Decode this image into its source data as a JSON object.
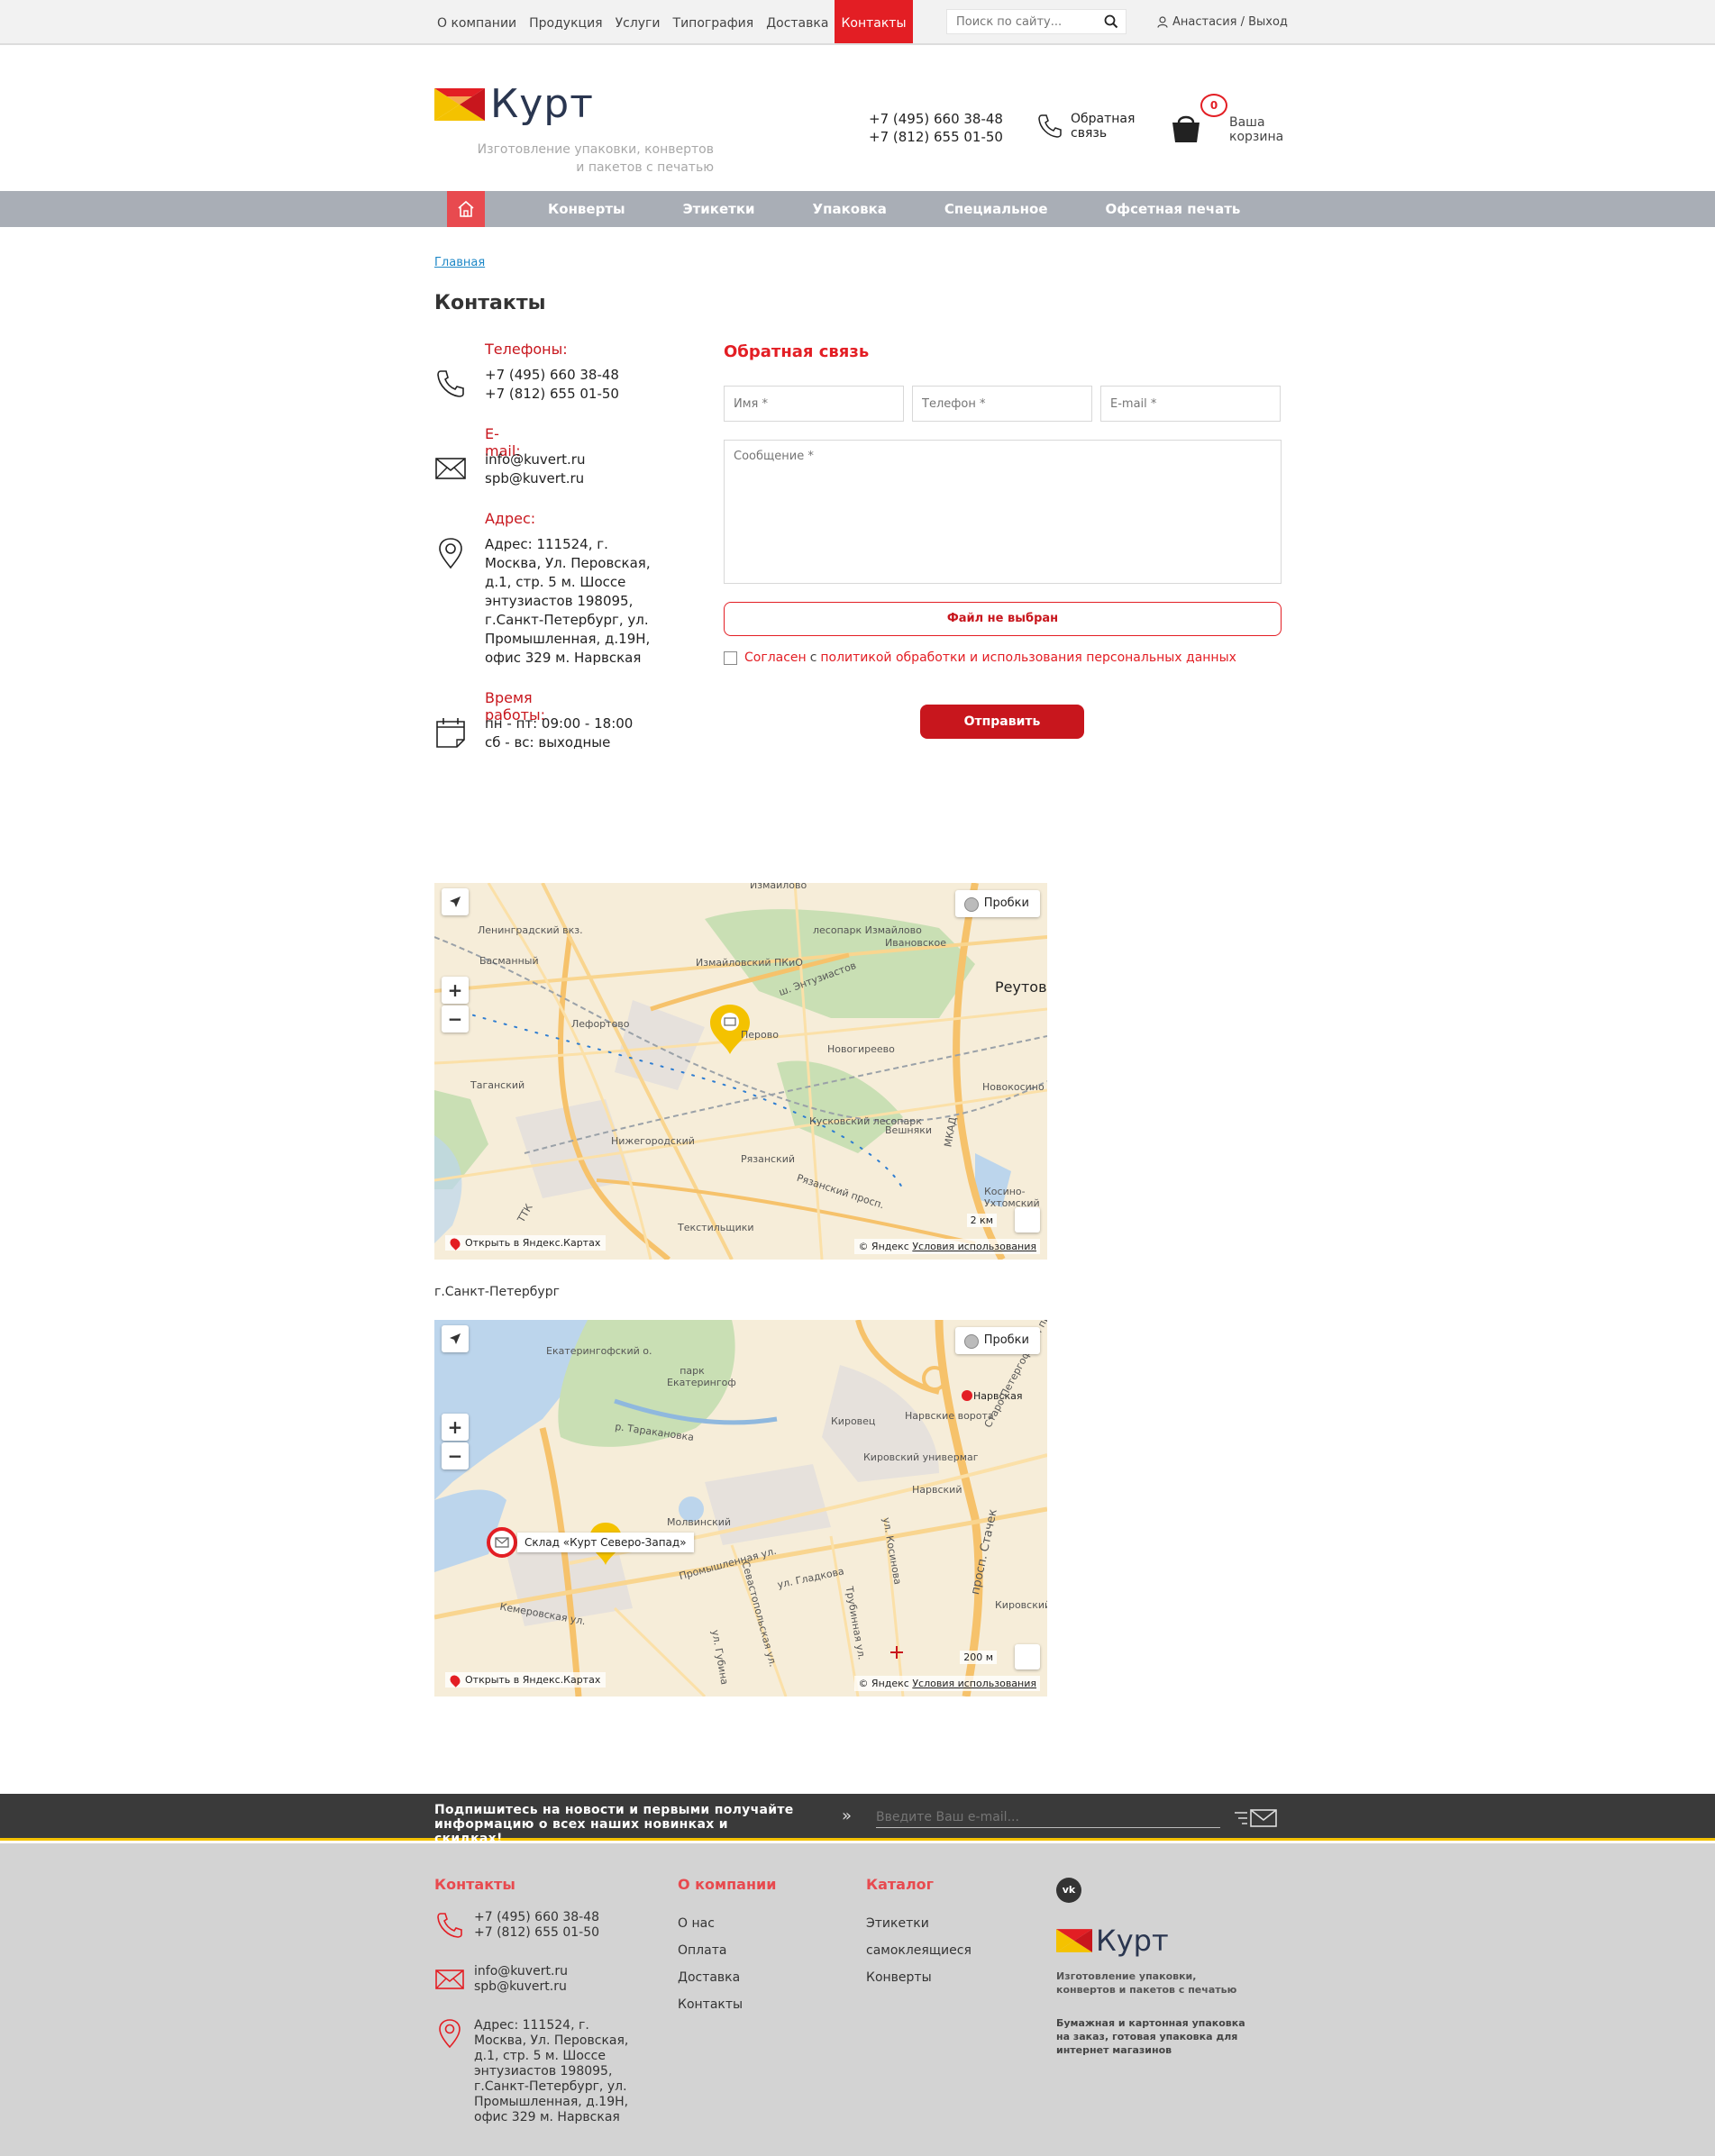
{
  "topnav": {
    "items": [
      "О компании",
      "Продукция",
      "Услуги",
      "Типография",
      "Доставка",
      "Контакты"
    ],
    "active_index": 5,
    "search_placeholder": "Поиск по сайту...",
    "user": "Анастасия / Выход"
  },
  "header": {
    "logo_text": "Курт",
    "tagline": "Изготовление упаковки, конвертов и пакетов с печатью",
    "phone1": "+7 (495) 660 38-48",
    "phone2": "+7 (812) 655 01-50",
    "callback_line1": "Обратная",
    "callback_line2": "связь",
    "cart_count": "0",
    "cart_line1": "Ваша",
    "cart_line2": "корзина"
  },
  "mainnav": {
    "items": [
      "Конверты",
      "Этикетки",
      "Упаковка",
      "Специальное",
      "Офсетная печать"
    ]
  },
  "breadcrumb": "Главная",
  "page_title": "Контакты",
  "contacts": {
    "phones_head": "Телефоны:",
    "phone1": "+7 (495) 660 38-48",
    "phone2": "+7 (812) 655 01-50",
    "email_head": "E-mail:",
    "email1": "info@kuvert.ru",
    "email2": "spb@kuvert.ru",
    "address_head": "Адрес:",
    "address": "Адрес: 111524, г. Москва, Ул. Перовская, д.1, стр. 5 м. Шоссе энтузиастов 198095, г.Санкт-Петербург, ул. Промышленная, д.19Н, офис 329 м. Нарвская",
    "hours_head": "Время работы:",
    "hours1": "пн - пт: 09:00 - 18:00",
    "hours2": "сб - вс: выходные"
  },
  "form": {
    "title": "Обратная связь",
    "name_placeholder": "Имя *",
    "phone_placeholder": "Телефон *",
    "email_placeholder": "E-mail *",
    "message_placeholder": "Сообщение *",
    "file_label": "Файл не выбран",
    "agree_prefix": "Согласен",
    "agree_sep": "с",
    "agree_link": "политикой обработки и использования персональных данных",
    "submit": "Отправить"
  },
  "map_moscow": {
    "traffic": "Пробки",
    "open": "Открыть в Яндекс.Картах",
    "copyright": "© Яндекс",
    "terms": "Условия использования",
    "scale": "2 км",
    "labels": [
      "Измайлово",
      "лесопарк Измайлово",
      "Ивановское",
      "Реутов",
      "Измайловский ПКиО",
      "ш. Энтузиастов",
      "Перово",
      "Лефортово",
      "Басманный",
      "Таганский",
      "Новогиреево",
      "Новокосино",
      "Нижегородский",
      "Кусковский лесопарк",
      "Вешняки",
      "Рязанский",
      "Рязанский просп.",
      "Текстильщики",
      "МКАД",
      "Косино-Ухтомский",
      "ТТК",
      "Ленинградский вкз."
    ]
  },
  "spb_caption": "г.Санкт-Петербург",
  "map_spb": {
    "traffic": "Пробки",
    "open": "Открыть в Яндекс.Картах",
    "copyright": "© Яндекс",
    "terms": "Условия использования",
    "scale": "200 м",
    "balloon": "Склад «Курт Северо-Запад»",
    "labels": [
      "Екатерингофский о.",
      "парк Екатерингоф",
      "р. Таракановка",
      "Кировец",
      "Нарвские ворота",
      "Нарвская",
      "Кировский универмаг",
      "Нарвский",
      "Молвинский",
      "Промышленная ул.",
      "Кемеровская ул.",
      "ул. Гладкова",
      "Севастопольская ул.",
      "просп. Стачек",
      "ул. Губина",
      "Трубинная ул.",
      "ул. Косинова",
      "Кировский сквер",
      "Старо-Петергофский просп."
    ]
  },
  "subscribe": {
    "text": "Подпишитесь на новости и первыми получайте информацию о всех наших новинках и скидках!",
    "placeholder": "Введите Ваш e-mail..."
  },
  "footer": {
    "contacts_head": "Контакты",
    "phone1": "+7 (495) 660 38-48",
    "phone2": "+7 (812) 655 01-50",
    "email1": "info@kuvert.ru",
    "email2": "spb@kuvert.ru",
    "address": "Адрес: 111524, г. Москва, Ул. Перовская, д.1, стр. 5 м. Шоссе энтузиастов 198095, г.Санкт-Петербург, ул. Промышленная, д.19Н, офис 329 м. Нарвская",
    "company_head": "О компании",
    "company_links": [
      "О нас",
      "Оплата",
      "Доставка",
      "Контакты"
    ],
    "catalog_head": "Каталог",
    "catalog_links": [
      "Этикетки",
      "самоклеящиеся",
      "Конверты"
    ],
    "vk": "vk",
    "logo_text": "Курт",
    "tagline": "Изготовление упаковки, конвертов и пакетов с печатью",
    "description": "Бумажная и картонная упаковка на заказ, готовая упаковка для интернет магазинов"
  },
  "colors": {
    "accent": "#e31e24",
    "nav_gray": "#a9aeb6",
    "footer_bg": "#d3d3d3",
    "subscribe_bg": "#3a3a3a",
    "subscribe_line": "#f4c200"
  },
  "icons": [
    "search-icon",
    "user-icon",
    "phone-icon",
    "cart-icon",
    "home-icon",
    "envelope-icon",
    "location-pin-icon",
    "calendar-icon",
    "mail-send-icon",
    "vk-icon"
  ]
}
